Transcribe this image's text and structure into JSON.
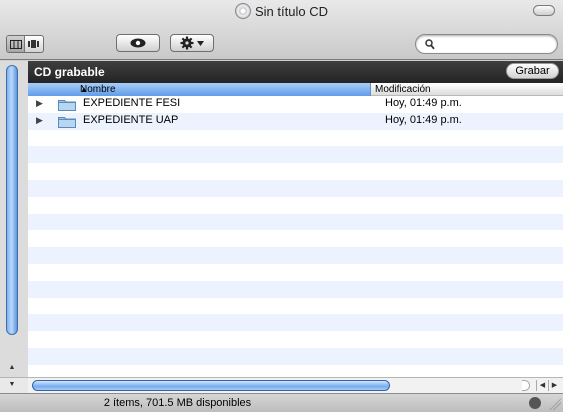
{
  "window": {
    "title": "Sin título CD"
  },
  "toolbar": {
    "view_buttons": [
      "icon-view",
      "list-view"
    ],
    "quick_look_icon": "eye-icon",
    "action_icon": "gear-icon",
    "search_placeholder": ""
  },
  "pane": {
    "title": "CD grabable",
    "burn_label": "Grabar"
  },
  "columns": {
    "name": "Nombre",
    "modified": "Modificación"
  },
  "files": [
    {
      "name": "EXPEDIENTE FESI",
      "modified": "Hoy, 01:49 p.m."
    },
    {
      "name": "EXPEDIENTE UAP",
      "modified": "Hoy, 01:49 p.m."
    }
  ],
  "status": {
    "text": "2 ítems, 701.5 MB disponibles"
  },
  "colors": {
    "header_dark": "#2e2e2e",
    "selected_column": "#5f9cea",
    "row_stripe": "#edf3fe"
  }
}
